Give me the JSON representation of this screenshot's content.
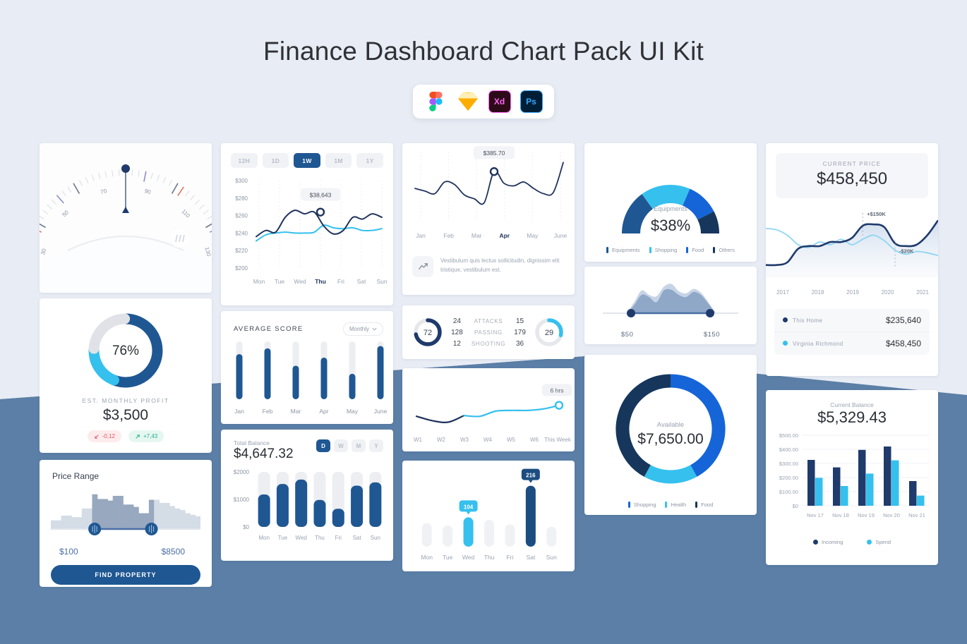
{
  "page": {
    "title": "Finance Dashboard Chart Pack UI Kit",
    "badges": [
      {
        "name": "figma",
        "label": "F"
      },
      {
        "name": "sketch",
        "label": "S"
      },
      {
        "name": "adobe-xd",
        "label": "Xd"
      },
      {
        "name": "photoshop",
        "label": "Ps"
      }
    ]
  },
  "colors": {
    "navy": "#1f5792",
    "dark_navy": "#174a7e",
    "blue": "#1565d8",
    "cyan": "#35c0ee",
    "light_gray": "#e6e8ec",
    "slate": "#5b7fa6",
    "page_bg": "#e8ecf4",
    "red": "#e8555f",
    "green": "#27b08b"
  },
  "speedometer": {
    "name": "speedometer-gauge",
    "ticks": [
      "30",
      "50",
      "70",
      "90",
      "110",
      "130"
    ],
    "needle_value": "90"
  },
  "profit_donut": {
    "percent": "76%",
    "label": "EST. MONTHLY PROFIT",
    "value": "$3,500",
    "chip_down": "-0,12",
    "chip_up": "+7,43",
    "segments": [
      {
        "name": "primary",
        "value": 56,
        "color": "#1f5792"
      },
      {
        "name": "secondary",
        "value": 20,
        "color": "#35c0ee"
      },
      {
        "name": "remainder",
        "value": 24,
        "color": "#e0e2e7"
      }
    ]
  },
  "price_range": {
    "title": "Price Range",
    "min_label": "$100",
    "max_label": "$8500",
    "button": "FIND PROPERTY",
    "histogram": [
      22,
      22,
      34,
      34,
      30,
      30,
      52,
      52,
      88,
      76,
      76,
      72,
      84,
      84,
      62,
      62,
      56,
      40,
      40,
      74,
      74,
      66,
      66,
      58,
      52,
      48,
      40,
      36,
      32
    ],
    "handle_min_index": 8,
    "handle_max_index": 19
  },
  "week_line": {
    "periods": [
      "12H",
      "1D",
      "1W",
      "1M",
      "1Y"
    ],
    "active_period": "1W",
    "chart_data": {
      "type": "line",
      "title": "",
      "xlabel": "",
      "ylabel": "",
      "ylim": [
        200,
        300
      ],
      "grid": true,
      "categories": [
        "Mon",
        "Tue",
        "Wed",
        "Thu",
        "Fri",
        "Sat",
        "Sun"
      ],
      "yticks": [
        "$300",
        "$280",
        "$260",
        "$240",
        "$220",
        "$200"
      ],
      "tooltip": {
        "label": "$38,643",
        "at": "Thu",
        "value": 264
      },
      "active_tick": "Thu",
      "series": [
        {
          "name": "primary",
          "color": "#20335c",
          "values": [
            236,
            243,
            241,
            258,
            266,
            262,
            264,
            248,
            239,
            243,
            258,
            256,
            262,
            258
          ]
        },
        {
          "name": "secondary",
          "color": "#35c0ee",
          "values": [
            231,
            238,
            240,
            241,
            240,
            240,
            241,
            249,
            246,
            245,
            246,
            243,
            243,
            245
          ]
        }
      ]
    }
  },
  "avg_score": {
    "title": "AVERAGE SCORE",
    "period": "Monthly",
    "chart_data": {
      "type": "bar",
      "title": "AVERAGE SCORE",
      "categories": [
        "Jan",
        "Feb",
        "Mar",
        "Apr",
        "May",
        "June"
      ],
      "values": [
        78,
        88,
        58,
        72,
        44,
        92
      ],
      "ylim": [
        0,
        100
      ],
      "grid": false
    }
  },
  "total_balance": {
    "label": "Total Balance",
    "value": "$4,647.32",
    "ranges": [
      "D",
      "W",
      "M",
      "Y"
    ],
    "active_range": "D",
    "chart_data": {
      "type": "bar",
      "title": "Total Balance",
      "categories": [
        "Mon",
        "Tue",
        "Wed",
        "Thu",
        "Fri",
        "Sat",
        "Sun"
      ],
      "values": [
        1180,
        1560,
        1720,
        980,
        660,
        1500,
        1620
      ],
      "yticks": [
        "$2000",
        "$1000",
        "$0"
      ],
      "ylim": [
        0,
        2000
      ],
      "grid": false
    }
  },
  "month_line": {
    "note": "Vestibulum quis lectus sollicitudin, dignissim elit tristique, vestibulum est.",
    "chart_data": {
      "type": "line",
      "title": "",
      "categories": [
        "Jan",
        "Feb",
        "Mar",
        "Apr",
        "May",
        "June"
      ],
      "active_tick": "Apr",
      "tooltip": {
        "label": "$385.70",
        "at": "Apr",
        "value": 78
      },
      "grid": true,
      "ylim": [
        0,
        100
      ],
      "series": [
        {
          "name": "price",
          "color": "#20335c",
          "values": [
            52,
            48,
            44,
            62,
            58,
            42,
            36,
            30,
            78,
            60,
            56,
            62,
            52,
            44,
            46,
            92
          ]
        }
      ]
    }
  },
  "match_stats": {
    "left_score": "72",
    "right_score": "29",
    "rows": [
      {
        "left": "24",
        "name": "ATTACKS",
        "right": "15"
      },
      {
        "left": "128",
        "name": "PASSING",
        "right": "179"
      },
      {
        "left": "12",
        "name": "SHOOTING",
        "right": "36"
      }
    ]
  },
  "weekly_trend": {
    "tooltip": "6 hrs",
    "chart_data": {
      "type": "line",
      "categories": [
        "W1",
        "W2",
        "W3",
        "W4",
        "W5",
        "W6",
        "This Week"
      ],
      "values": [
        42,
        30,
        26,
        44,
        42,
        56,
        58,
        58,
        62,
        72
      ],
      "grid": false,
      "ylim": [
        0,
        100
      ]
    }
  },
  "day_bars": {
    "chart_data": {
      "type": "bar",
      "categories": [
        "Mon",
        "Tue",
        "Wed",
        "Thu",
        "Fri",
        "Sat",
        "Sun"
      ],
      "values": [
        48,
        40,
        104,
        60,
        44,
        216,
        36
      ],
      "highlights": [
        {
          "category": "Wed",
          "label": "104",
          "color": "#35c0ee"
        },
        {
          "category": "Sat",
          "label": "216",
          "color": "#1c4d80"
        }
      ],
      "ylim": [
        0,
        240
      ],
      "grid": false
    }
  },
  "gauge": {
    "category": "Equipments",
    "value": "$38%",
    "legend": [
      {
        "label": "Equipments",
        "color": "#1f5792"
      },
      {
        "label": "Shopping",
        "color": "#35c0ee"
      },
      {
        "label": "Food",
        "color": "#1565d8"
      },
      {
        "label": "Others",
        "color": "#16365c"
      }
    ],
    "chart_data": {
      "type": "pie",
      "categories": [
        "Equipments",
        "Shopping",
        "Food",
        "Others"
      ],
      "values": [
        30,
        33,
        22,
        15
      ]
    }
  },
  "range_area": {
    "min_label": "$50",
    "max_label": "$150",
    "chart_data": {
      "type": "area",
      "series": [
        {
          "name": "upper",
          "color": "#c7d4e6",
          "values": [
            0,
            30,
            62,
            50,
            46,
            72,
            80,
            60,
            54,
            66,
            56,
            30,
            0
          ]
        },
        {
          "name": "lower",
          "color": "#8fa8c8",
          "values": [
            0,
            22,
            50,
            44,
            30,
            62,
            64,
            50,
            44,
            58,
            50,
            26,
            0
          ]
        }
      ]
    }
  },
  "available_donut": {
    "label": "Available",
    "value": "$7,650.00",
    "legend": [
      {
        "label": "Shopping",
        "color": "#1565d8"
      },
      {
        "label": "Health",
        "color": "#35c0ee"
      },
      {
        "label": "Food",
        "color": "#16365c"
      }
    ],
    "chart_data": {
      "type": "pie",
      "categories": [
        "Shopping",
        "Health",
        "Food"
      ],
      "values": [
        42,
        16,
        42
      ]
    }
  },
  "current_price": {
    "label": "CURRENT PRICE",
    "value": "$458,450",
    "annotation_high": "+$150K",
    "annotation_low": "-$20K",
    "rows": [
      {
        "name": "This Home",
        "value": "$235,640",
        "color": "#1f3a6b"
      },
      {
        "name": "Virginia Richmond",
        "value": "$458,450",
        "color": "#35c0ee"
      }
    ],
    "chart_data": {
      "type": "area",
      "categories": [
        "2017",
        "2018",
        "2019",
        "2020",
        "2021"
      ],
      "grid": false,
      "ylim": [
        0,
        100
      ],
      "series": [
        {
          "name": "This Home",
          "color": "#1f3a6b",
          "values": [
            18,
            18,
            22,
            42,
            46,
            46,
            52,
            52,
            58,
            76,
            78,
            74,
            50,
            46,
            48,
            62,
            84
          ]
        },
        {
          "name": "Virginia Richmond",
          "color": "#8ed6f2",
          "values": [
            72,
            70,
            62,
            48,
            44,
            52,
            48,
            56,
            48,
            56,
            62,
            54,
            40,
            34,
            38,
            36,
            32
          ]
        }
      ]
    }
  },
  "balance_bars": {
    "label": "Current Balance",
    "value": "$5,329.43",
    "legend": [
      {
        "label": "Incoming",
        "color": "#1f3a6b"
      },
      {
        "label": "Spend",
        "color": "#35c0ee"
      }
    ],
    "chart_data": {
      "type": "bar",
      "title": "Current Balance",
      "categories": [
        "Nov 17",
        "Nov 18",
        "Nov 19",
        "Nov 20",
        "Nov 21"
      ],
      "yticks": [
        "$500.00",
        "$400.00",
        "$300.00",
        "$200.00",
        "$100.00",
        "$0"
      ],
      "ylim": [
        0,
        500
      ],
      "grid": true,
      "series": [
        {
          "name": "Incoming",
          "color": "#1f3a6b",
          "values": [
            325,
            272,
            396,
            420,
            175
          ]
        },
        {
          "name": "Spend",
          "color": "#35c0ee",
          "values": [
            198,
            140,
            228,
            322,
            72
          ]
        }
      ]
    }
  }
}
